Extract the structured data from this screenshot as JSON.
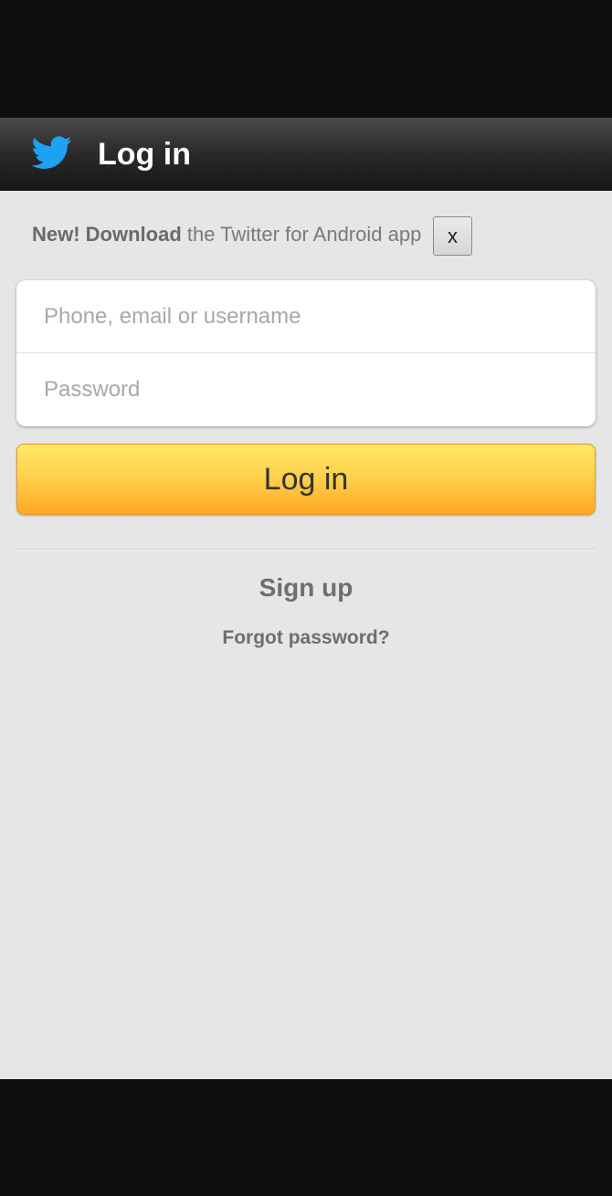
{
  "header": {
    "title": "Log in",
    "logo_icon": "twitter-bird-icon",
    "logo_color": "#1da1f2"
  },
  "promo": {
    "bold_text": "New! Download",
    "text": " the Twitter for Android app",
    "close_label": "x"
  },
  "form": {
    "username_placeholder": "Phone, email or username",
    "username_value": "",
    "password_placeholder": "Password",
    "password_value": "",
    "login_label": "Log in"
  },
  "links": {
    "signup": "Sign up",
    "forgot_password": "Forgot password?"
  },
  "colors": {
    "login_button": "#ffc83d",
    "background": "#e6e6e6",
    "header": "#2c2c2c"
  }
}
